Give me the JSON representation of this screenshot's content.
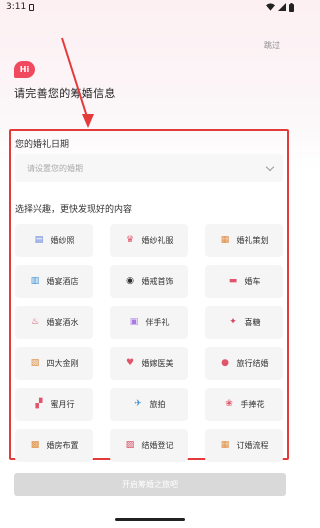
{
  "status": {
    "time": "3:11"
  },
  "skip_label": "跳过",
  "hi_label": "Hi",
  "page_title": "请完善您的筹婚信息",
  "date_section": {
    "label": "您的婚礼日期",
    "placeholder": "请设置您的婚期"
  },
  "interest_section": {
    "label": "选择兴趣，更快发现好的内容"
  },
  "tiles": [
    {
      "label": "婚纱照",
      "icon": "wedding-photo-icon",
      "glyph": "▤",
      "color": "#5b7bd6"
    },
    {
      "label": "婚纱礼服",
      "icon": "wedding-dress-icon",
      "glyph": "♛",
      "color": "#e0556a"
    },
    {
      "label": "婚礼策划",
      "icon": "wedding-planning-icon",
      "glyph": "▦",
      "color": "#e0873a"
    },
    {
      "label": "婚宴酒店",
      "icon": "hotel-icon",
      "glyph": "▥",
      "color": "#3a8fd6"
    },
    {
      "label": "婚戒首饰",
      "icon": "ring-icon",
      "glyph": "◉",
      "color": "#2e2e2e"
    },
    {
      "label": "婚车",
      "icon": "car-icon",
      "glyph": "▬",
      "color": "#e0556a"
    },
    {
      "label": "婚宴酒水",
      "icon": "wine-icon",
      "glyph": "♨",
      "color": "#d6455a"
    },
    {
      "label": "伴手礼",
      "icon": "gift-icon",
      "glyph": "▣",
      "color": "#a77be0"
    },
    {
      "label": "喜糖",
      "icon": "candy-icon",
      "glyph": "✦",
      "color": "#d6455a"
    },
    {
      "label": "四大金刚",
      "icon": "camera-icon",
      "glyph": "▧",
      "color": "#e08a3a"
    },
    {
      "label": "婚嫁医美",
      "icon": "beauty-icon",
      "glyph": "♥",
      "color": "#e0556a"
    },
    {
      "label": "旅行结婚",
      "icon": "balloon-icon",
      "glyph": "●",
      "color": "#e0556a"
    },
    {
      "label": "蜜月行",
      "icon": "honeymoon-icon",
      "glyph": "▞",
      "color": "#e0556a"
    },
    {
      "label": "旅拍",
      "icon": "travel-photo-icon",
      "glyph": "✈",
      "color": "#3a8fd6"
    },
    {
      "label": "手捧花",
      "icon": "bouquet-icon",
      "glyph": "❀",
      "color": "#e0556a"
    },
    {
      "label": "婚房布置",
      "icon": "room-decor-icon",
      "glyph": "▩",
      "color": "#e08a3a"
    },
    {
      "label": "结婚登记",
      "icon": "registration-icon",
      "glyph": "▨",
      "color": "#d6455a"
    },
    {
      "label": "订婚流程",
      "icon": "engagement-icon",
      "glyph": "▦",
      "color": "#e08a3a"
    }
  ],
  "start_button": {
    "label": "开启筹婚之旅吧"
  },
  "colors": {
    "accent": "#f14a5e",
    "highlight": "#e53a3a",
    "button_disabled": "#d9d9d9"
  }
}
